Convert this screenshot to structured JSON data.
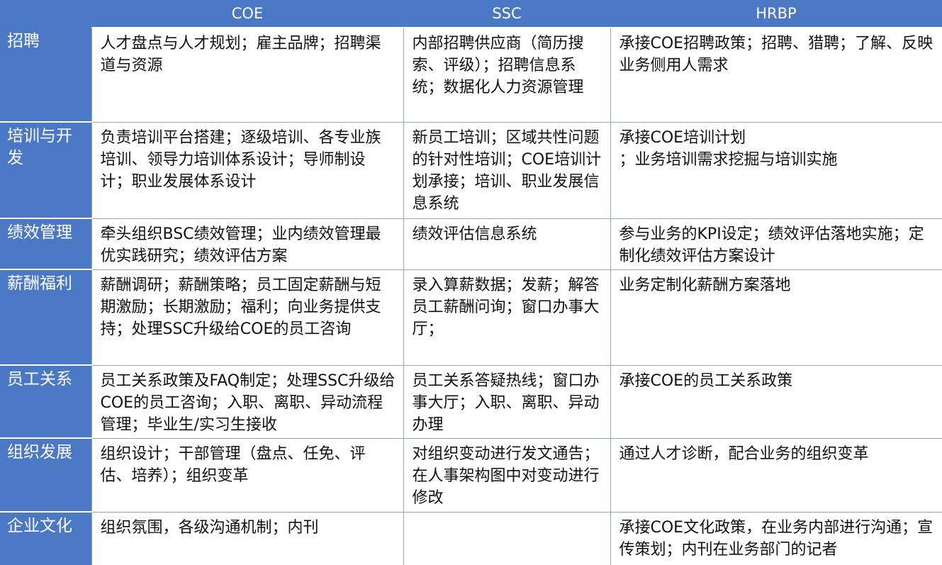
{
  "columns": [
    "",
    "COE",
    "SSC",
    "HRBP"
  ],
  "rows": [
    {
      "label": "招聘",
      "coe": "人才盘点与人才规划；雇主品牌；招聘渠道与资源",
      "ssc": "内部招聘供应商（简历搜索、评级）；招聘信息系统；数据化人力资源管理",
      "hrbp": "承接COE招聘政策；招聘、猎聘；了解、反映业务侧用人需求"
    },
    {
      "label": "培训与开发",
      "coe": "负责培训平台搭建；逐级培训、各专业族培训、领导力培训体系设计；导师制设计；职业发展体系设计",
      "ssc": "新员工培训；区域共性问题的针对性培训；COE培训计划承接；培训、职业发展信息系统",
      "hrbp": "承接COE培训计划\n；业务培训需求挖掘与培训实施"
    },
    {
      "label": "绩效管理",
      "coe": "牵头组织BSC绩效管理；业内绩效管理最优实践研究；绩效评估方案",
      "ssc": "绩效评估信息系统",
      "hrbp": "参与业务的KPI设定；绩效评估落地实施；定制化绩效评估方案设计"
    },
    {
      "label": "薪酬福利",
      "coe": "薪酬调研；薪酬策略；员工固定薪酬与短期激励；长期激励；福利；向业务提供支持；处理SSC升级给COE的员工咨询",
      "ssc": "录入算薪数据；发薪；解答员工薪酬问询；窗口办事大厅；",
      "hrbp": "业务定制化薪酬方案落地"
    },
    {
      "label": "员工关系",
      "coe": "员工关系政策及FAQ制定；处理SSC升级给COE的员工咨询；入职、离职、异动流程管理；毕业生/实习生接收",
      "ssc": "员工关系答疑热线；窗口办事大厅；入职、离职、异动办理",
      "hrbp": "承接COE的员工关系政策"
    },
    {
      "label": "组织发展",
      "coe": "组织设计；干部管理（盘点、任免、评估、培养）；组织变革",
      "ssc": "对组织变动进行发文通告；在人事架构图中对变动进行修改",
      "hrbp": "通过人才诊断，配合业务的组织变革"
    },
    {
      "label": "企业文化",
      "coe": "组织氛围，各级沟通机制；内刊",
      "ssc": "",
      "hrbp": "承接COE文化政策，在业务内部进行沟通；宣传策划；内刊在业务部门的记者"
    }
  ],
  "colors": {
    "header_bg": "#4a78c4",
    "header_text": "#ffffff",
    "cell_bg": "#ffffff",
    "cell_text": "#111111",
    "grid_line": "#8aa4d4"
  }
}
